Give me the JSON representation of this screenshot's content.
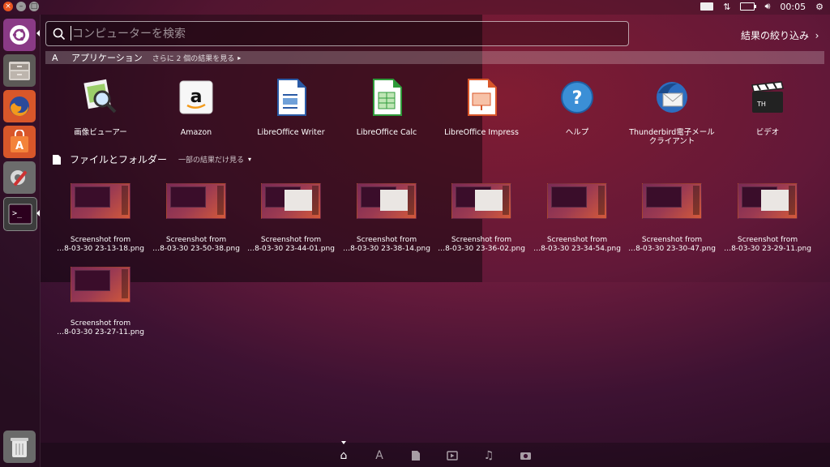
{
  "topbar": {
    "clock": "00:05",
    "icons": [
      "keyboard-icon",
      "network-icon",
      "battery-icon",
      "volume-icon",
      "gear-icon"
    ]
  },
  "launcher": {
    "items": [
      "dash-home",
      "files",
      "firefox",
      "software-center",
      "system-settings",
      "terminal",
      "trash"
    ]
  },
  "search": {
    "placeholder": "コンピューターを検索",
    "value": ""
  },
  "filter_label": "結果の絞り込み",
  "applications": {
    "title": "アプリケーション",
    "more": "さらに 2 個の結果を見る",
    "items": [
      {
        "label": "画像ビューアー",
        "icon": "image-viewer-icon"
      },
      {
        "label": "Amazon",
        "icon": "amazon-icon"
      },
      {
        "label": "LibreOffice Writer",
        "icon": "libreoffice-writer-icon"
      },
      {
        "label": "LibreOffice Calc",
        "icon": "libreoffice-calc-icon"
      },
      {
        "label": "LibreOffice Impress",
        "icon": "libreoffice-impress-icon"
      },
      {
        "label": "ヘルプ",
        "icon": "help-icon"
      },
      {
        "label": "Thunderbird電子メール\nクライアント",
        "icon": "thunderbird-icon"
      },
      {
        "label": "ビデオ",
        "icon": "video-icon"
      }
    ]
  },
  "files": {
    "title": "ファイルとフォルダー",
    "more": "一部の結果だけ見る",
    "items": [
      {
        "line1": "Screenshot from",
        "line2": "…8-03-30 23-13-18.png",
        "kind": "terminal"
      },
      {
        "line1": "Screenshot from",
        "line2": "…8-03-30 23-50-38.png",
        "kind": "terminal"
      },
      {
        "line1": "Screenshot from",
        "line2": "…8-03-30 23-44-01.png",
        "kind": "dialog"
      },
      {
        "line1": "Screenshot from",
        "line2": "…8-03-30 23-38-14.png",
        "kind": "dialog"
      },
      {
        "line1": "Screenshot from",
        "line2": "…8-03-30 23-36-02.png",
        "kind": "dialog"
      },
      {
        "line1": "Screenshot from",
        "line2": "…8-03-30 23-34-54.png",
        "kind": "terminal"
      },
      {
        "line1": "Screenshot from",
        "line2": "…8-03-30 23-30-47.png",
        "kind": "terminal"
      },
      {
        "line1": "Screenshot from",
        "line2": "…8-03-30 23-29-11.png",
        "kind": "dialog"
      },
      {
        "line1": "Screenshot from",
        "line2": "…8-03-30 23-27-11.png",
        "kind": "terminal"
      }
    ]
  },
  "lenses": [
    "home-lens-icon",
    "applications-lens-icon",
    "files-lens-icon",
    "video-lens-icon",
    "music-lens-icon",
    "photos-lens-icon"
  ],
  "colors": {
    "accent": "#e95420",
    "background": "#6a1b3c"
  }
}
